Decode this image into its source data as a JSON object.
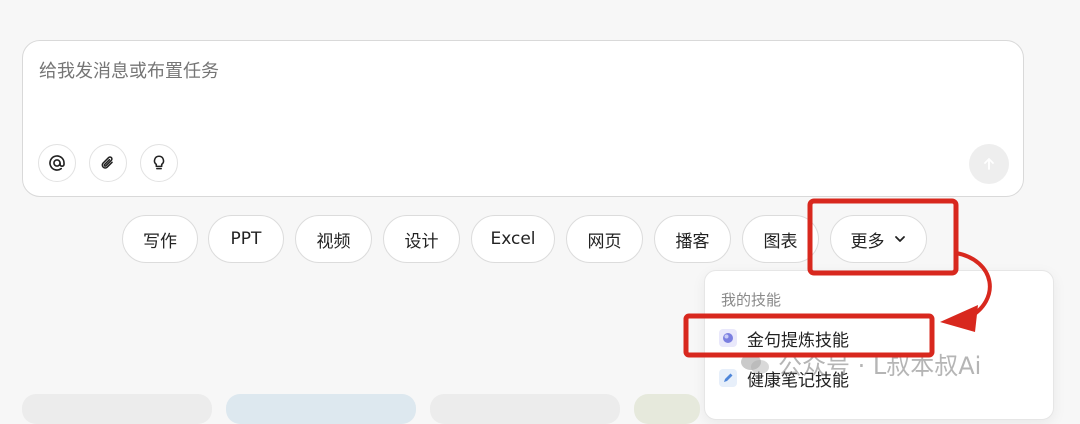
{
  "composer": {
    "placeholder": "给我发消息或布置任务",
    "tools": [
      {
        "icon": "at-icon"
      },
      {
        "icon": "paperclip-icon"
      },
      {
        "icon": "lightbulb-icon"
      }
    ],
    "send_icon": "send-arrow-icon"
  },
  "chips": {
    "writing": "写作",
    "ppt": "PPT",
    "video": "视频",
    "design": "设计",
    "excel": "Excel",
    "webpage": "网页",
    "podcast": "播客",
    "chart": "图表",
    "more": "更多"
  },
  "menu": {
    "heading": "我的技能",
    "items": [
      {
        "label": "金句提炼技能",
        "icon": "sphere-icon"
      },
      {
        "label": "健康笔记技能",
        "icon": "pencil-icon"
      }
    ]
  },
  "watermark": {
    "text": "公众号 · L叔本叔Ai"
  },
  "colors": {
    "annotation_red": "#d8281e",
    "page_bg": "#f7f7f7"
  }
}
